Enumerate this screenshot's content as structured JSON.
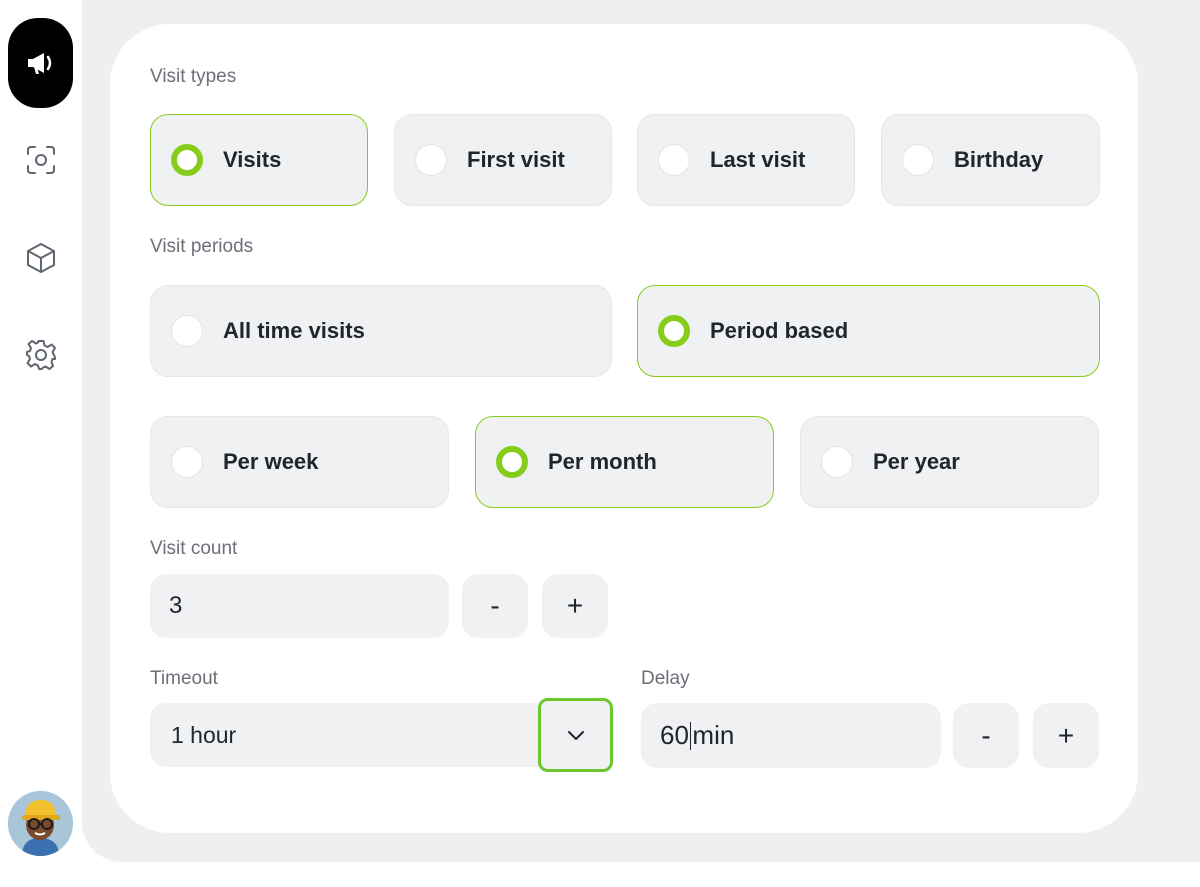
{
  "sections": {
    "visit_types": "Visit types",
    "visit_periods": "Visit periods",
    "visit_count": "Visit count",
    "timeout": "Timeout",
    "delay": "Delay"
  },
  "visit_types": [
    {
      "label": "Visits",
      "selected": true
    },
    {
      "label": "First visit",
      "selected": false
    },
    {
      "label": "Last visit",
      "selected": false
    },
    {
      "label": "Birthday",
      "selected": false
    }
  ],
  "visit_periods": [
    {
      "label": "All time visits",
      "selected": false
    },
    {
      "label": "Period based",
      "selected": true
    }
  ],
  "period_granularity": [
    {
      "label": "Per week",
      "selected": false
    },
    {
      "label": "Per month",
      "selected": true
    },
    {
      "label": "Per year",
      "selected": false
    }
  ],
  "visit_count": {
    "value": "3",
    "minus": "-",
    "plus": "+"
  },
  "timeout": {
    "value": "1 hour"
  },
  "delay": {
    "value": "60",
    "unit": "min",
    "minus": "-",
    "plus": "+"
  },
  "colors": {
    "accent": "#86cd1b",
    "surface": "#eff1f2",
    "stage": "#efefef"
  },
  "icons": [
    "megaphone-icon",
    "scan-icon",
    "box-icon",
    "gear-icon",
    "chevron-down-icon"
  ]
}
